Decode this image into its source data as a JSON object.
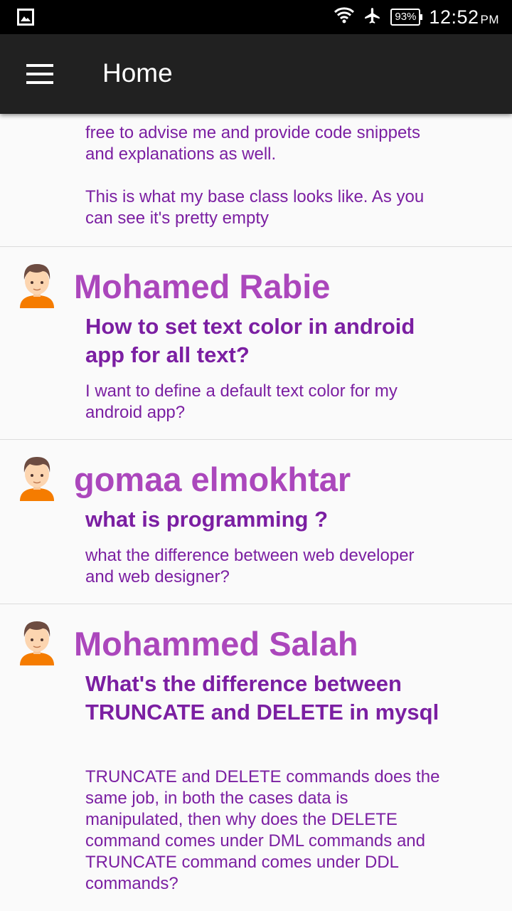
{
  "status_bar": {
    "battery": "93%",
    "time": "12:52",
    "ampm": "PM",
    "icons": [
      "image-notification-icon",
      "wifi-icon",
      "airplane-mode-icon",
      "battery-icon"
    ]
  },
  "app_bar": {
    "title": "Home",
    "menu_icon": "hamburger-menu-icon",
    "background": "#212121"
  },
  "colors": {
    "author": "#ab47bc",
    "question": "#7b1fa2",
    "body": "#7b1fa2",
    "background": "#fafafa"
  },
  "feed": {
    "partial_body": "free to advise me and provide code snippets and explanations as well.\n\nThis is what my base class looks like. As you can see it's pretty empty",
    "posts": [
      {
        "author": "Mohamed Rabie",
        "question": "How to set text color in android app for all text?",
        "body": "I want to define a default text color for my android app?"
      },
      {
        "author": "gomaa elmokhtar",
        "question": "what is programming ?",
        "body": "what the difference between web developer and web designer?"
      },
      {
        "author": "Mohammed Salah",
        "question": "What's the difference between TRUNCATE and DELETE in mysql",
        "body": "TRUNCATE and DELETE commands does the same job, in both the cases data is manipulated, then why does the DELETE command comes under DML commands and TRUNCATE command comes under DDL commands?"
      }
    ]
  }
}
